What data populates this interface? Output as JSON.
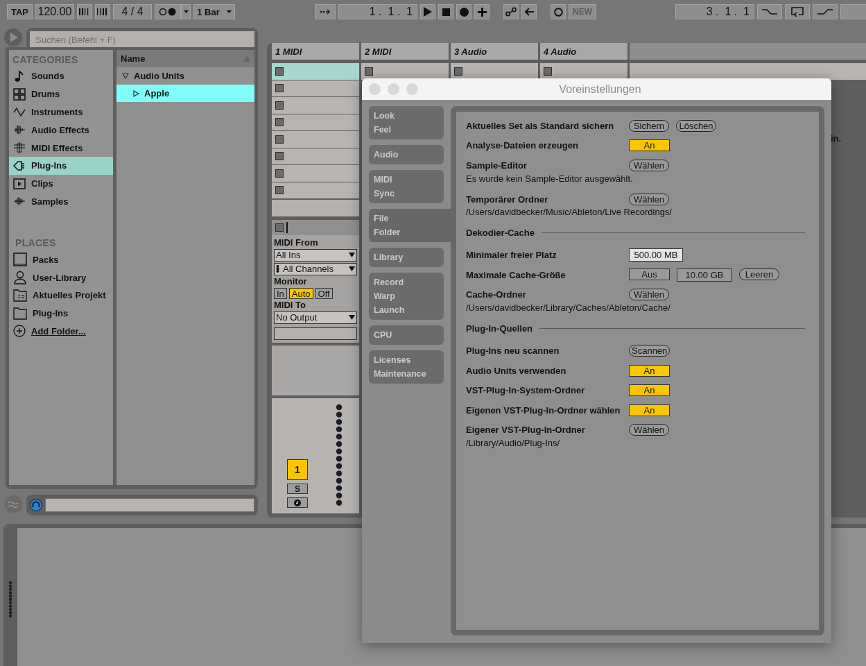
{
  "transport": {
    "tap": "TAP",
    "tempo": "120.00",
    "signature": "4 / 4",
    "quantization": "1 Bar",
    "position": "1 .  1 .  1",
    "new_label": "NEW",
    "loop_start": "3 .  1 .  1"
  },
  "browser": {
    "search": {
      "placeholder": "Suchen (Befehl + F)"
    },
    "categories_heading": "CATEGORIES",
    "categories": [
      {
        "label": "Sounds",
        "kind": "note",
        "selected": false
      },
      {
        "label": "Drums",
        "kind": "grid",
        "selected": false
      },
      {
        "label": "Instruments",
        "kind": "wave",
        "selected": false
      },
      {
        "label": "Audio Effects",
        "kind": "audiofx",
        "selected": false
      },
      {
        "label": "MIDI Effects",
        "kind": "midifx",
        "selected": false
      },
      {
        "label": "Plug-Ins",
        "kind": "plug",
        "selected": true
      },
      {
        "label": "Clips",
        "kind": "clip",
        "selected": false
      },
      {
        "label": "Samples",
        "kind": "samples",
        "selected": false
      }
    ],
    "places_heading": "PLACES",
    "places": [
      {
        "label": "Packs",
        "kind": "packs",
        "selected": false
      },
      {
        "label": "User-Library",
        "kind": "user",
        "selected": false
      },
      {
        "label": "Aktuelles Projekt",
        "kind": "project",
        "selected": false
      },
      {
        "label": "Plug-Ins",
        "kind": "folder",
        "selected": false
      },
      {
        "label": "Add Folder...",
        "kind": "add",
        "selected": false
      }
    ],
    "name_column": "Name",
    "tree": [
      {
        "label": "Audio Units",
        "expanded": true,
        "selected": false,
        "children": [
          {
            "label": "Apple",
            "expanded": false,
            "selected": true
          }
        ]
      }
    ]
  },
  "tracks": [
    {
      "name": "1 MIDI",
      "slots": [
        {
          "selected": true
        },
        {
          "selected": false
        },
        {
          "selected": false
        },
        {
          "selected": false
        },
        {
          "selected": false
        },
        {
          "selected": false
        },
        {
          "selected": false
        },
        {
          "selected": false
        }
      ]
    },
    {
      "name": "2 MIDI",
      "slots": [
        {
          "selected": false
        }
      ]
    },
    {
      "name": "3 Audio",
      "slots": [
        {
          "selected": false
        }
      ]
    },
    {
      "name": "4 Audio",
      "slots": [
        {
          "selected": false
        }
      ]
    }
  ],
  "track_io": {
    "midi_from_label": "MIDI From",
    "input_type": "All Ins",
    "input_channel": "All Channels",
    "monitor_label": "Monitor",
    "monitor": [
      {
        "label": "In",
        "selected": false
      },
      {
        "label": "Auto",
        "selected": true
      },
      {
        "label": "Off",
        "selected": false
      }
    ],
    "midi_to_label": "MIDI To",
    "output_type": "No Output"
  },
  "mixer": {
    "track_number": "1",
    "activator_on": true,
    "solo": "S"
  },
  "background_hint": "in.",
  "preferences": {
    "title": "Voreinstellungen",
    "tabs": [
      {
        "lines": [
          "Look",
          "Feel"
        ],
        "selected": false
      },
      {
        "lines": [
          "Audio"
        ],
        "selected": false
      },
      {
        "lines": [
          "MIDI",
          "Sync"
        ],
        "selected": false
      },
      {
        "lines": [
          "File",
          "Folder"
        ],
        "selected": true
      },
      {
        "lines": [
          "Library"
        ],
        "selected": false
      },
      {
        "lines": [
          "Record",
          "Warp",
          "Launch"
        ],
        "selected": false
      },
      {
        "lines": [
          "CPU"
        ],
        "selected": false
      },
      {
        "lines": [
          "Licenses",
          "Maintenance"
        ],
        "selected": false
      }
    ],
    "rows": [
      {
        "kind": "setting",
        "label": "Aktuelles Set als Standard sichern",
        "controls": [
          {
            "kind": "pill",
            "label": "Sichern"
          },
          {
            "kind": "pill",
            "label": "Löschen"
          }
        ]
      },
      {
        "kind": "setting",
        "label": "Analyse-Dateien erzeugen",
        "controls": [
          {
            "kind": "toggle",
            "label": "An",
            "on": true
          }
        ]
      },
      {
        "kind": "setting",
        "label": "Sample-Editor",
        "controls": [
          {
            "kind": "pill",
            "label": "Wählen"
          }
        ]
      },
      {
        "kind": "note",
        "text": "Es wurde kein Sample-Editor ausgewählt."
      },
      {
        "kind": "setting",
        "label": "Temporärer Ordner",
        "controls": [
          {
            "kind": "pill",
            "label": "Wählen"
          }
        ]
      },
      {
        "kind": "note",
        "text": "/Users/davidbecker/Music/Ableton/Live Recordings/"
      },
      {
        "kind": "section",
        "label": "Dekodier-Cache"
      },
      {
        "kind": "setting",
        "label": "Minimaler freier Platz",
        "controls": [
          {
            "kind": "value",
            "label": "500.00 MB",
            "disabled": false
          }
        ]
      },
      {
        "kind": "setting",
        "label": "Maximale Cache-Größe",
        "controls": [
          {
            "kind": "toggle",
            "label": "Aus",
            "on": false
          },
          {
            "kind": "value",
            "label": "10.00 GB",
            "disabled": true
          },
          {
            "kind": "pill",
            "label": "Leeren"
          }
        ]
      },
      {
        "kind": "setting",
        "label": "Cache-Ordner",
        "controls": [
          {
            "kind": "pill",
            "label": "Wählen"
          }
        ]
      },
      {
        "kind": "note",
        "text": "/Users/davidbecker/Library/Caches/Ableton/Cache/"
      },
      {
        "kind": "section",
        "label": "Plug-In-Quellen"
      },
      {
        "kind": "setting",
        "label": "Plug-Ins neu scannen",
        "controls": [
          {
            "kind": "pill",
            "label": "Scannen"
          }
        ]
      },
      {
        "kind": "setting",
        "label": "Audio Units verwenden",
        "controls": [
          {
            "kind": "toggle",
            "label": "An",
            "on": true
          }
        ]
      },
      {
        "kind": "setting",
        "label": "VST-Plug-In-System-Ordner",
        "controls": [
          {
            "kind": "toggle",
            "label": "An",
            "on": true
          }
        ]
      },
      {
        "kind": "setting",
        "label": "Eigenen VST-Plug-In-Ordner wählen",
        "controls": [
          {
            "kind": "toggle",
            "label": "An",
            "on": true
          }
        ]
      },
      {
        "kind": "setting",
        "label": "Eigener VST-Plug-In-Ordner",
        "controls": [
          {
            "kind": "pill",
            "label": "Wählen"
          }
        ]
      },
      {
        "kind": "note",
        "text": "/Library/Audio/Plug-Ins/"
      }
    ]
  }
}
